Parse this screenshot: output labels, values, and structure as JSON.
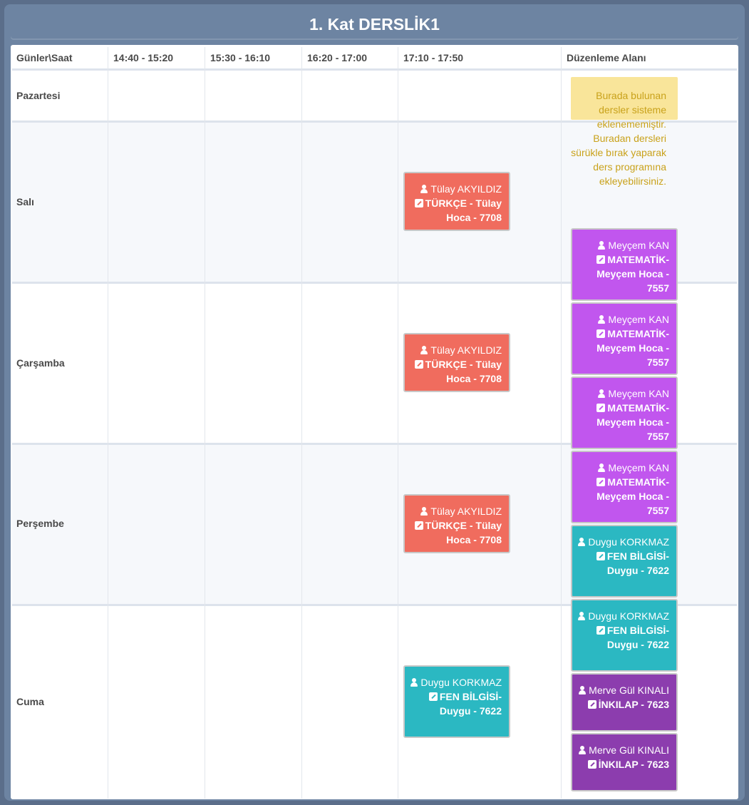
{
  "title": "1. Kat DERSLİK1",
  "header": {
    "corner": "Günler\\Saat",
    "slots": [
      "14:40 - 15:20",
      "15:30 - 16:10",
      "16:20 - 17:00",
      "17:10 - 17:50"
    ],
    "edit_area": "Düzenleme Alanı"
  },
  "days": [
    "Pazartesi",
    "Salı",
    "Çarşamba",
    "Perşembe",
    "Cuma"
  ],
  "note": "Burada bulunan dersler sisteme eklenememiştir. Buradan dersleri sürükle bırak yaparak ders programına ekleyebilirsiniz.",
  "colors": {
    "turkce": "#f06c5e",
    "matematik": "#c156ee",
    "fen": "#2bb8c2",
    "inkilap": "#8c3dae"
  },
  "lessons": [
    {
      "teacher": "Tülay AKYILDIZ",
      "course": "TÜRKÇE - Tülay Hoca - 7708"
    },
    {
      "teacher": "Tülay AKYILDIZ",
      "course": "TÜRKÇE - Tülay Hoca - 7708"
    },
    {
      "teacher": "Tülay AKYILDIZ",
      "course": "TÜRKÇE - Tülay Hoca - 7708"
    },
    {
      "teacher": "Duygu KORKMAZ",
      "course": "FEN BİLGİSİ-Duygu - 7622"
    }
  ],
  "pool": [
    {
      "teacher": "Meyçem KAN",
      "course": "MATEMATİK-Meyçem Hoca - 7557"
    },
    {
      "teacher": "Meyçem KAN",
      "course": "MATEMATİK-Meyçem Hoca - 7557"
    },
    {
      "teacher": "Meyçem KAN",
      "course": "MATEMATİK-Meyçem Hoca - 7557"
    },
    {
      "teacher": "Meyçem KAN",
      "course": "MATEMATİK-Meyçem Hoca - 7557"
    },
    {
      "teacher": "Duygu KORKMAZ",
      "course": "FEN BİLGİSİ-Duygu - 7622"
    },
    {
      "teacher": "Duygu KORKMAZ",
      "course": "FEN BİLGİSİ-Duygu - 7622"
    },
    {
      "teacher": "Merve Gül KINALI",
      "course": "İNKILAP - 7623"
    },
    {
      "teacher": "Merve Gül KINALI",
      "course": "İNKILAP - 7623"
    }
  ]
}
